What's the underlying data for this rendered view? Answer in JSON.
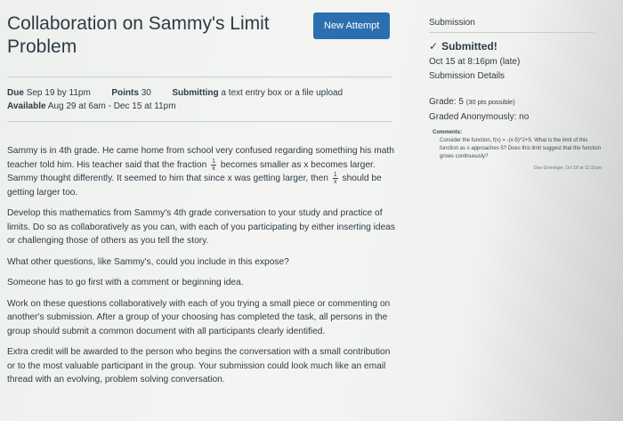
{
  "assignment": {
    "title": "Collaboration on Sammy's Limit Problem",
    "new_attempt_label": "New Attempt",
    "due_label": "Due",
    "due_value": "Sep 19 by 11pm",
    "points_label": "Points",
    "points_value": "30",
    "submitting_label": "Submitting",
    "submitting_value": "a text entry box or a file upload",
    "available_label": "Available",
    "available_value": "Aug 29 at 6am - Dec 15 at 11pm"
  },
  "description": {
    "p1_a": "Sammy is in 4th grade. He came home from school very confused regarding something his math teacher told him. His teacher said that the fraction",
    "frac1_num": "1",
    "frac1_den": "x",
    "p1_b": "becomes smaller as x becomes larger. Sammy thought differently. It seemed to him that since x was getting larger, then",
    "frac2_num": "1",
    "frac2_den": "x",
    "p1_c": "should be getting larger too.",
    "p2": "Develop this mathematics from Sammy's 4th grade conversation to your study and practice of limits. Do so as collaboratively as you can, with each of you participating by either inserting ideas or challenging those of others as you tell the story.",
    "p3": "What other questions, like Sammy's, could you include in this expose?",
    "p4": "Someone has to go first with a comment or beginning idea.",
    "p5": "Work on these questions collaboratively with each of you trying a small piece or commenting on another's submission. After a group of your choosing has completed the task, all persons in the group should submit a common document with all participants clearly identified.",
    "p6": "Extra credit will be awarded to the person who begins the conversation with a small contribution or to the most valuable participant in the group. Your submission could look much like an email thread with an evolving, problem solving conversation."
  },
  "submission": {
    "heading": "Submission",
    "status": "Submitted!",
    "date": "Oct 15 at 8:16pm (late)",
    "details_link": "Submission Details",
    "grade_label": "Grade:",
    "grade_value": "5",
    "grade_possible": "(30 pts possible)",
    "anonymous": "Graded Anonymously: no"
  },
  "comments": {
    "label": "Comments:",
    "text": "Consider the function, f(x) = -(x-5)^2+5. What is the limit of this function as x approaches 5? Does this limit suggest that the function grows continuously?",
    "author": "Don Groninger, Oct 18 at 11:32am"
  }
}
